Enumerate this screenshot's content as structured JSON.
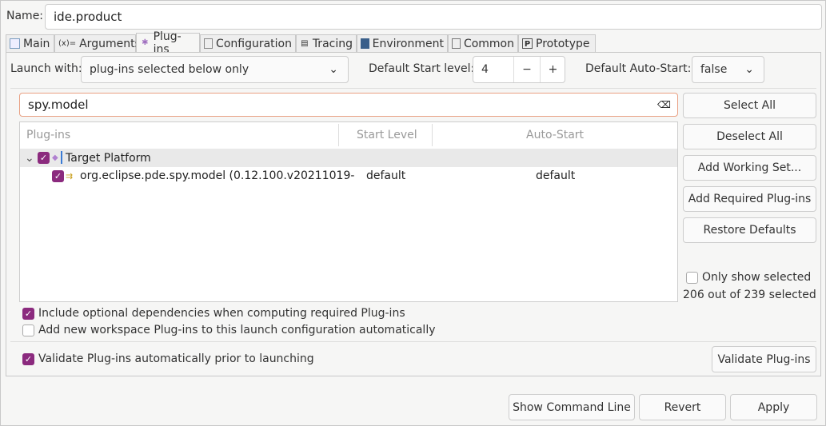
{
  "name_label": "Name:",
  "name_value": "ide.product",
  "tabs": [
    {
      "label": "Main",
      "icon": "main-icon"
    },
    {
      "label": "Arguments",
      "icon": "arguments-icon"
    },
    {
      "label": "Plug-ins",
      "icon": "plugins-icon",
      "active": true
    },
    {
      "label": "Configuration",
      "icon": "configuration-icon"
    },
    {
      "label": "Tracing",
      "icon": "tracing-icon"
    },
    {
      "label": "Environment",
      "icon": "environment-icon"
    },
    {
      "label": "Common",
      "icon": "common-icon"
    },
    {
      "label": "Prototype",
      "icon": "prototype-icon"
    }
  ],
  "launch_with_label": "Launch with:",
  "launch_with_value": "plug-ins selected below only",
  "start_level_label": "Default Start level:",
  "start_level_value": "4",
  "stepper_minus": "−",
  "stepper_plus": "+",
  "auto_start_label": "Default Auto-Start:",
  "auto_start_value": "false",
  "filter_value": "spy.model",
  "table": {
    "headers": [
      "Plug-ins",
      "Start Level",
      "Auto-Start"
    ],
    "rows": [
      {
        "label": "Target Platform",
        "start": "",
        "auto": "",
        "checked": true,
        "expanded": true
      },
      {
        "label": "org.eclipse.pde.spy.model (0.12.100.v20211019-",
        "start": "default",
        "auto": "default",
        "checked": true
      }
    ]
  },
  "side_buttons": [
    "Select All",
    "Deselect All",
    "Add Working Set...",
    "Add Required Plug-ins",
    "Restore Defaults"
  ],
  "only_show_selected": "Only show selected",
  "selected_count": "206 out of 239 selected",
  "options": [
    {
      "label": "Include optional dependencies when computing required Plug-ins",
      "checked": true
    },
    {
      "label": "Add new workspace Plug-ins to this launch configuration automatically",
      "checked": false
    }
  ],
  "validate_auto": {
    "label": "Validate Plug-ins automatically prior to launching",
    "checked": true
  },
  "validate_button": "Validate Plug-ins",
  "footer": {
    "show_cmd": "Show Command Line",
    "revert": "Revert",
    "apply": "Apply"
  },
  "colors": {
    "checkbox": "#8b2a7e",
    "filter_border": "#e9a083"
  }
}
